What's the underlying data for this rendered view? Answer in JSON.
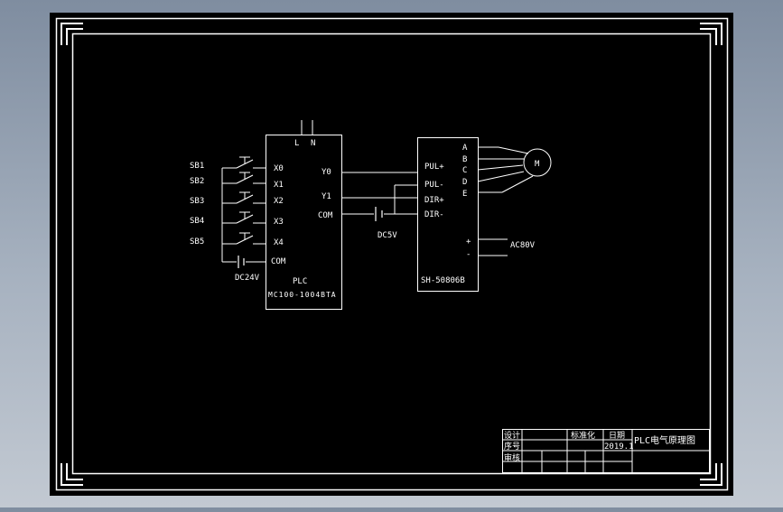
{
  "inputs": {
    "switches": [
      "SB1",
      "SB2",
      "SB3",
      "SB4",
      "SB5"
    ],
    "terminals": [
      "X0",
      "X1",
      "X2",
      "X3",
      "X4"
    ],
    "com": "COM",
    "supply": "DC24V"
  },
  "plc": {
    "power_terminals": [
      "L",
      "N"
    ],
    "outputs": [
      "Y0",
      "Y1"
    ],
    "out_com": "COM",
    "label": "PLC",
    "model": "MC100-1004BTA"
  },
  "signal_supply": "DC5V",
  "driver": {
    "inputs": [
      "PUL+",
      "PUL-",
      "DIR+",
      "DIR-"
    ],
    "phases": [
      "A",
      "B",
      "C",
      "D",
      "E"
    ],
    "plus": "+",
    "minus": "-",
    "model": "SH-50806B",
    "supply": "AC80V"
  },
  "motor": {
    "label": "M"
  },
  "title_block": {
    "design": "设计",
    "number": "序号",
    "review": "审核",
    "standardize": "标准化",
    "date_label": "日期",
    "date_value": "2019.1",
    "title": "PLC电气原理图"
  }
}
